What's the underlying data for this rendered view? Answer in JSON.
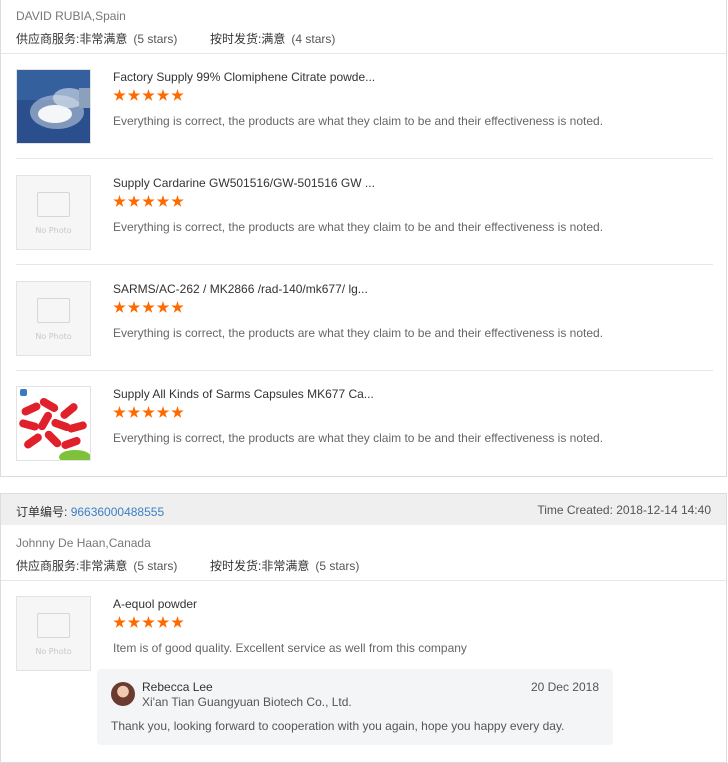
{
  "review1": {
    "buyer": "DAVID RUBIA,Spain",
    "supplier_service_label": "供应商服务:",
    "supplier_service_value": "非常满意",
    "supplier_service_stars": "(5 stars)",
    "delivery_label": "按时发货:",
    "delivery_value": "满意",
    "delivery_stars": "(4 stars)",
    "items": [
      {
        "title": "Factory Supply 99% Clomiphene Citrate powde...",
        "rating": 5,
        "comment": "Everything is correct, the products are what they claim to be and their effectiveness is noted.",
        "image": "product-photo-powder"
      },
      {
        "title": "Supply Cardarine GW501516/GW-501516 GW ...",
        "rating": 5,
        "comment": "Everything is correct, the products are what they claim to be and their effectiveness is noted.",
        "image": "no-photo",
        "no_photo_text": "No Photo"
      },
      {
        "title": "SARMS/AC-262 / MK2866 /rad-140/mk677/ lg...",
        "rating": 5,
        "comment": "Everything is correct, the products are what they claim to be and their effectiveness is noted.",
        "image": "no-photo",
        "no_photo_text": "No Photo"
      },
      {
        "title": "Supply All Kinds of Sarms Capsules MK677 Ca...",
        "rating": 5,
        "comment": "Everything is correct, the products are what they claim to be and their effectiveness is noted.",
        "image": "product-photo-capsules"
      }
    ]
  },
  "review2": {
    "order_label": "订单编号:",
    "order_number": "96636000488555",
    "time_created": "Time Created: 2018-12-14 14:40",
    "buyer": "Johnny De Haan,Canada",
    "supplier_service_label": "供应商服务:",
    "supplier_service_value": "非常满意",
    "supplier_service_stars": "(5 stars)",
    "delivery_label": "按时发货:",
    "delivery_value": "非常满意",
    "delivery_stars": "(5 stars)",
    "item": {
      "title": "A-equol powder",
      "rating": 5,
      "comment": "Item is of good quality. Excellent service as well from this company",
      "image": "no-photo",
      "no_photo_text": "No Photo"
    },
    "reply": {
      "name": "Rebecca Lee",
      "company": "Xi'an Tian Guangyuan Biotech Co., Ltd.",
      "date": "20 Dec 2018",
      "text": "Thank you, looking forward to cooperation with you again, hope you happy every day."
    }
  },
  "colors": {
    "star": "#ff6a00",
    "link": "#3b7fc4",
    "order_bar": "#efefef"
  }
}
